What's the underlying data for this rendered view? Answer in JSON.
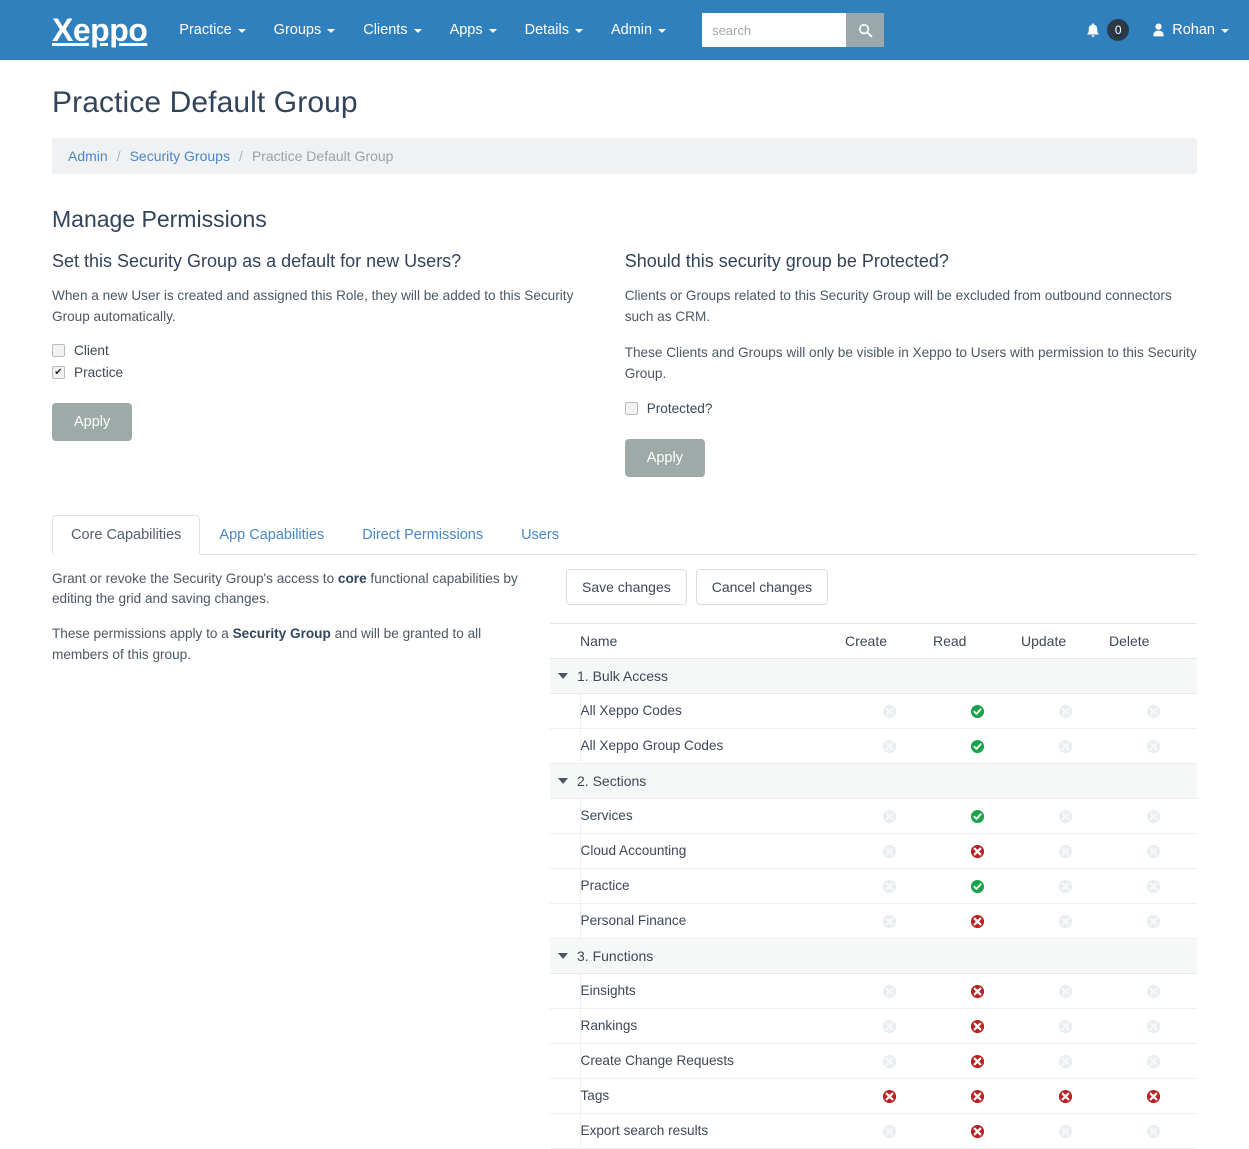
{
  "navbar": {
    "brand": "Xeppo",
    "menu": [
      {
        "label": "Practice",
        "caret": true
      },
      {
        "label": "Groups",
        "caret": true
      },
      {
        "label": "Clients",
        "caret": true
      },
      {
        "label": "Apps",
        "caret": true
      },
      {
        "label": "Details",
        "caret": true
      },
      {
        "label": "Admin",
        "caret": true
      }
    ],
    "search": {
      "placeholder": "search",
      "value": "",
      "icon": "search-icon"
    },
    "notifications": {
      "icon": "bell-icon",
      "count": "0"
    },
    "user": {
      "icon": "user-icon",
      "name": "Rohan",
      "caret": true
    },
    "bg_color": "#2f80bd"
  },
  "page": {
    "title": "Practice Default Group",
    "breadcrumb": [
      {
        "label": "Admin",
        "link": true
      },
      {
        "label": "Security Groups",
        "link": true
      },
      {
        "label": "Practice Default Group",
        "link": false
      }
    ],
    "breadcrumb_separator": "/",
    "section_title": "Manage Permissions"
  },
  "default_panel": {
    "heading": "Set this Security Group as a default for new Users?",
    "description": "When a new User is created and assigned this Role, they will be added to this Security Group automatically.",
    "checkboxes": [
      {
        "label": "Client",
        "checked": false
      },
      {
        "label": "Practice",
        "checked": true
      }
    ],
    "apply_label": "Apply"
  },
  "protected_panel": {
    "heading": "Should this security group be Protected?",
    "description_1": "Clients or Groups related to this Security Group will be excluded from outbound connectors such as CRM.",
    "description_2": "These Clients and Groups will only be visible in Xeppo to Users with permission to this Security Group.",
    "checkbox": {
      "label": "Protected?",
      "checked": false
    },
    "apply_label": "Apply"
  },
  "tabs": [
    {
      "label": "Core Capabilities",
      "active": true
    },
    {
      "label": "App Capabilities",
      "active": false
    },
    {
      "label": "Direct Permissions",
      "active": false
    },
    {
      "label": "Users",
      "active": false
    }
  ],
  "tab_description": {
    "line1_a": "Grant or revoke the Security Group's access to ",
    "line1_b": "core",
    "line1_c": " functional capabilities by editing the grid and saving changes.",
    "line2_a": "These permissions apply to a ",
    "line2_b": "Security Group",
    "line2_c": " and will be granted to all members of this group."
  },
  "grid": {
    "toolbar": {
      "save_label": "Save changes",
      "cancel_label": "Cancel changes"
    },
    "columns": [
      "Name",
      "Create",
      "Read",
      "Update",
      "Delete"
    ],
    "groups": [
      {
        "label": "1. Bulk Access",
        "expanded": true,
        "rows": [
          {
            "name": "All Xeppo Codes",
            "create": "none",
            "read": "allow",
            "update": "none",
            "delete": "none"
          },
          {
            "name": "All Xeppo Group Codes",
            "create": "none",
            "read": "allow",
            "update": "none",
            "delete": "none"
          }
        ]
      },
      {
        "label": "2. Sections",
        "expanded": true,
        "rows": [
          {
            "name": "Services",
            "create": "none",
            "read": "allow",
            "update": "none",
            "delete": "none"
          },
          {
            "name": "Cloud Accounting",
            "create": "none",
            "read": "deny",
            "update": "none",
            "delete": "none"
          },
          {
            "name": "Practice",
            "create": "none",
            "read": "allow",
            "update": "none",
            "delete": "none"
          },
          {
            "name": "Personal Finance",
            "create": "none",
            "read": "deny",
            "update": "none",
            "delete": "none"
          }
        ]
      },
      {
        "label": "3. Functions",
        "expanded": true,
        "rows": [
          {
            "name": "Einsights",
            "create": "none",
            "read": "deny",
            "update": "none",
            "delete": "none"
          },
          {
            "name": "Rankings",
            "create": "none",
            "read": "deny",
            "update": "none",
            "delete": "none"
          },
          {
            "name": "Create Change Requests",
            "create": "none",
            "read": "deny",
            "update": "none",
            "delete": "none"
          },
          {
            "name": "Tags",
            "create": "deny",
            "read": "deny",
            "update": "deny",
            "delete": "deny"
          },
          {
            "name": "Export search results",
            "create": "none",
            "read": "deny",
            "update": "none",
            "delete": "none"
          }
        ]
      }
    ]
  },
  "colors": {
    "brand_blue": "#2f80bd",
    "link_blue": "#4a87c7",
    "allow_green": "#19a44a",
    "deny_red": "#b92020",
    "none_gray": "#e8edef",
    "apply_button": "#9daaa7"
  }
}
